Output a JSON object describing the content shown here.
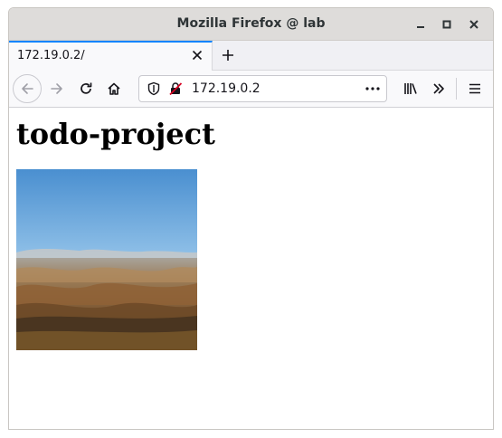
{
  "window": {
    "title": "Mozilla Firefox @ lab"
  },
  "tabs": [
    {
      "label": "172.19.0.2/"
    }
  ],
  "navbar": {
    "url": "172.19.0.2"
  },
  "page": {
    "heading": "todo-project"
  },
  "icons": {
    "minimize": "minimize-icon",
    "maximize": "maximize-icon",
    "close": "close-icon",
    "tab_close": "close-icon",
    "new_tab": "plus-icon",
    "back": "arrow-left-icon",
    "forward": "arrow-right-icon",
    "reload": "reload-icon",
    "home": "home-icon",
    "shield": "shield-icon",
    "insecure": "insecure-lock-icon",
    "page_actions": "more-horizontal-icon",
    "library": "library-icon",
    "overflow": "chevron-double-right-icon",
    "menu": "hamburger-menu-icon"
  },
  "colors": {
    "accent": "#0a84ff",
    "titlebar": "#dedcda",
    "toolbar": "#f9f9fb",
    "insecure": "#d70022"
  }
}
